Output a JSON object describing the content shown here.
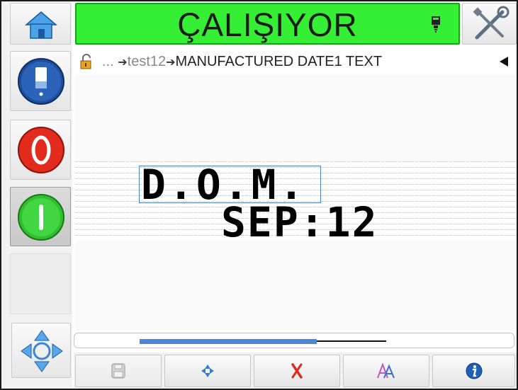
{
  "status": {
    "text": "ÇALIŞIYOR",
    "color": "#35ef35"
  },
  "sidebar": {
    "home_icon": "home-icon",
    "ink_icon": "ink-cartridge-icon",
    "stop_icon": "stop-icon",
    "start_icon": "start-icon",
    "nav_icon": "navigation-arrows-icon"
  },
  "tools": {
    "icon": "tools-icon"
  },
  "breadcrumb": {
    "ellipsis": "...",
    "arrow": "➔",
    "items": [
      "test12",
      "MANUFACTURED DATE1 TEXT"
    ]
  },
  "canvas": {
    "objects": [
      {
        "text": "D.O.M.",
        "selected": true
      },
      {
        "text": "SEP:12",
        "selected": false
      }
    ]
  },
  "scroll": {
    "position_fraction": 0.4
  },
  "toolbar": {
    "buttons": [
      {
        "icon": "save-icon",
        "enabled": false
      },
      {
        "icon": "move-icon",
        "enabled": true
      },
      {
        "icon": "delete-icon",
        "enabled": true
      },
      {
        "icon": "font-icon",
        "enabled": true
      },
      {
        "icon": "info-icon",
        "enabled": true
      }
    ]
  }
}
